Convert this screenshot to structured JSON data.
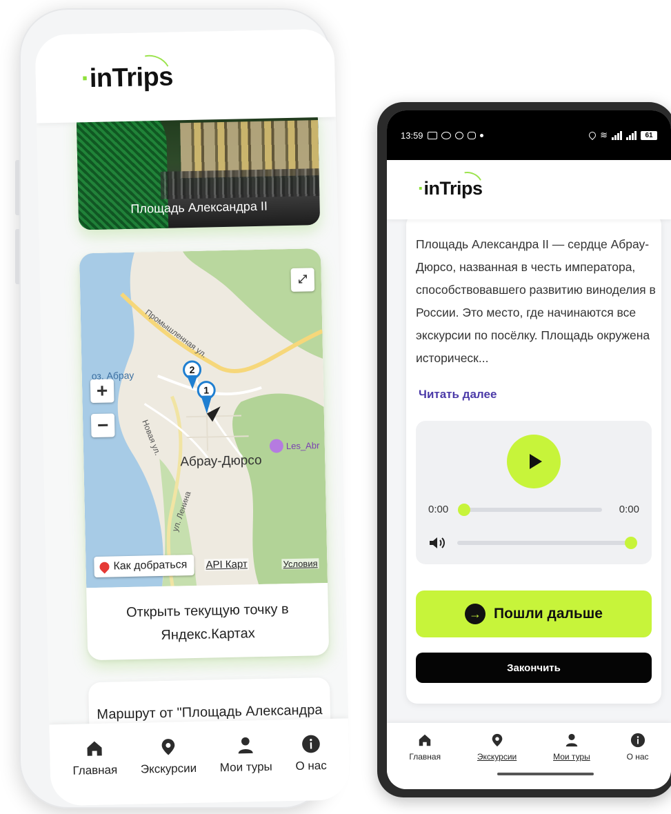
{
  "brand": {
    "logo_text": "inTrips",
    "accent_color": "#c7f43a",
    "logo_arc_color": "#9be34c",
    "link_color": "#4b3aa8",
    "divider_color": "#31c05a"
  },
  "left_phone": {
    "place_card": {
      "caption": "Площадь Александра II"
    },
    "map": {
      "zoom_in_label": "+",
      "zoom_out_label": "−",
      "town_label": "Абрау-Дюрсо",
      "lake_label": "оз. Абрау",
      "street_labels": [
        "Промышленная ул.",
        "Новая ул.",
        "ул. Ленина"
      ],
      "poi_label": "Les_Abr",
      "markers": [
        "2",
        "1"
      ],
      "route_button_label": "Как добраться",
      "api_link": "API Карт",
      "terms_link": "Условия",
      "open_link": "Открыть текущую точку в Яндекс.Картах"
    },
    "route_card": {
      "title": "Маршрут от \"Площадь Александра"
    },
    "nav": [
      "Главная",
      "Экскурсии",
      "Мои туры",
      "О нас"
    ]
  },
  "right_phone": {
    "status_bar": {
      "time": "13:59",
      "battery": "61"
    },
    "description": "Площадь Александра II — сердце Абрау-Дюрсо, названная в честь императора, способствовавшего развитию виноделия в России. Это место, где начинаются все экскурсии по посёлку. Площадь окружена историческ...",
    "read_more": "Читать далее",
    "player": {
      "current_time": "0:00",
      "duration": "0:00",
      "progress": 0,
      "volume": 1
    },
    "go_button": "Пошли дальше",
    "end_button": "Закончить",
    "nav": [
      "Главная",
      "Экскурсии",
      "Мои туры",
      "О нас"
    ]
  }
}
